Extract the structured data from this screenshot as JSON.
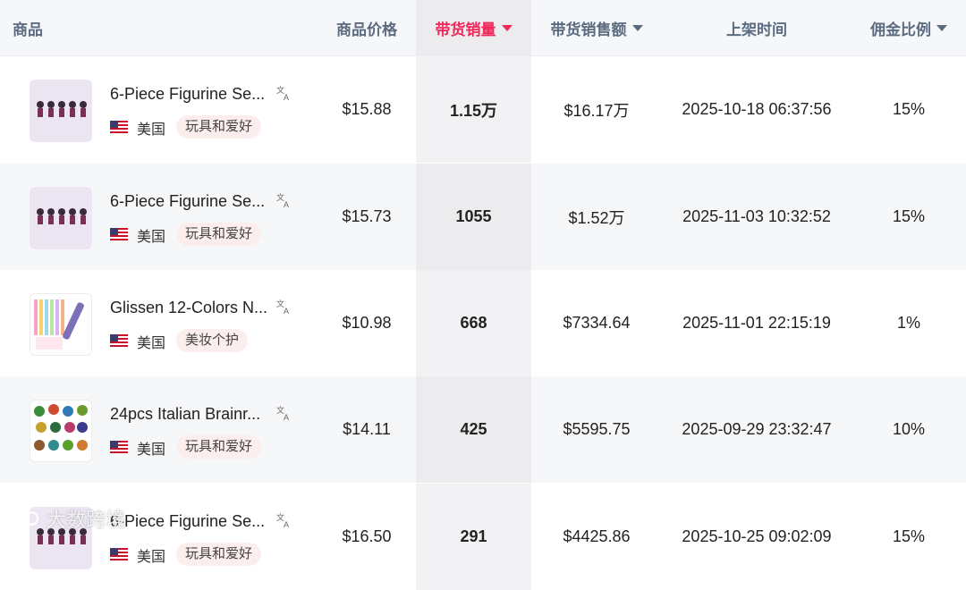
{
  "header": {
    "product": "商品",
    "price": "商品价格",
    "sales_volume": "带货销量",
    "sales_amount": "带货销售额",
    "listing_time": "上架时间",
    "commission": "佣金比例"
  },
  "colors": {
    "accent": "#f2295b",
    "header_text": "#5b6b80",
    "tag_bg": "#fdeeee"
  },
  "rows": [
    {
      "title": "6-Piece Figurine Se...",
      "country": "美国",
      "category": "玩具和爱好",
      "price": "$15.88",
      "sales": "1.15万",
      "amount": "$16.17万",
      "time": "2025-10-18 06:37:56",
      "commission": "15%",
      "thumb_icon": "figurine-icon"
    },
    {
      "title": "6-Piece Figurine Se...",
      "country": "美国",
      "category": "玩具和爱好",
      "price": "$15.73",
      "sales": "1055",
      "amount": "$1.52万",
      "time": "2025-11-03 10:32:52",
      "commission": "15%",
      "thumb_icon": "figurine-icon"
    },
    {
      "title": "Glissen 12-Colors N...",
      "country": "美国",
      "category": "美妆个护",
      "price": "$10.98",
      "sales": "668",
      "amount": "$7334.64",
      "time": "2025-11-01 22:15:19",
      "commission": "1%",
      "thumb_icon": "nail-polish-icon"
    },
    {
      "title": "24pcs Italian Brainr...",
      "country": "美国",
      "category": "玩具和爱好",
      "price": "$14.11",
      "sales": "425",
      "amount": "$5595.75",
      "time": "2025-09-29 23:32:47",
      "commission": "10%",
      "thumb_icon": "figures-icon"
    },
    {
      "title": "6-Piece Figurine Se...",
      "country": "美国",
      "category": "玩具和爱好",
      "price": "$16.50",
      "sales": "291",
      "amount": "$4425.86",
      "time": "2025-10-25 09:02:09",
      "commission": "15%",
      "thumb_icon": "figurine-icon"
    }
  ],
  "watermark": "大数跨境"
}
